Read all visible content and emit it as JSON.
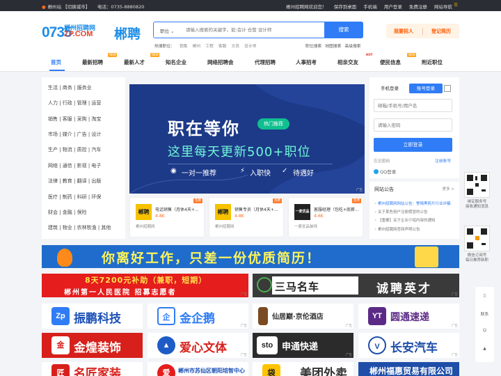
{
  "topbar": {
    "site": "郴州站",
    "switch_city": "【切换城市】",
    "phone": "电话：0735-8880820",
    "welcome": "郴州招聘网欢迎您！",
    "links": [
      "保存到桌面",
      "手机端",
      "用户登录",
      "免费注册",
      "网站导航"
    ]
  },
  "header": {
    "logo_num": "0735",
    "logo_cn": "郴州招聘网",
    "logo_domain": "ZP.COM",
    "logo_brand": "郴聘",
    "search_category": "职位",
    "search_placeholder": "请输入搜索的关键字，如:会计 仓管 设计师",
    "search_button": "搜索",
    "hot_label": "热搜职位：",
    "hot_keywords": [
      "销售",
      "郴州",
      "工程",
      "客服",
      "文员",
      "设计师"
    ],
    "right_links": [
      "职位搜索",
      "地图搜索",
      "高级搜索"
    ],
    "btn_recruit": "我要招人",
    "btn_resume": "登记简历"
  },
  "nav": {
    "items": [
      "首页",
      "最新招聘",
      "最新人才",
      "知名企业",
      "网络招聘会",
      "代理招聘",
      "人事招考",
      "相亲交友",
      "便民信息",
      "附近职位"
    ],
    "new_tag": "NEW",
    "hot_tag": "HOT"
  },
  "categories": [
    "生活 | 商务 | 服务业",
    "人力 | 行政 | 管理 | 运营",
    "销售 | 客服 | 采购 | 淘宝",
    "市场 | 媒介 | 广告 | 设计",
    "生产 | 物流 | 质控 | 汽车",
    "网络 | 通信 | 影视 | 电子",
    "法律 | 教育 | 翻译 | 出版",
    "医疗 | 制药 | 科研 | 环保",
    "财会 | 金融 | 保险",
    "建筑 | 物业 | 农林牧渔 | 其他"
  ],
  "banner": {
    "title": "职在等你",
    "pill": "热门推荐",
    "subtitle": "这里每天更新500+职位",
    "features": [
      "一对一推荐",
      "入职快",
      "待遇好"
    ],
    "ad_label": "广告"
  },
  "jobs": [
    {
      "logo": "郴聘",
      "title": "电话销售（月休4天+...",
      "salary": "4-8K",
      "company": "郴州招聘网",
      "tag": "急聘"
    },
    {
      "logo": "郴聘",
      "title": "销售专员（月休4天+...",
      "salary": "4-8K",
      "company": "郴州招聘网",
      "tag": "急聘"
    },
    {
      "logo": "一麦优品",
      "title": "客服经理（包吃+底薪...",
      "salary": "4-6K",
      "company": "一麦优品装饰",
      "tag": "急聘"
    }
  ],
  "login": {
    "tab_phone": "手机登录",
    "tab_account": "账号登录",
    "username_placeholder": "邮箱/手机号/用户名",
    "password_placeholder": "请输入密码",
    "submit": "立即登录",
    "forgot": "忘记密码",
    "register": "注册账号",
    "qq": "QQ登录"
  },
  "notice": {
    "title": "网站公告",
    "more": "更多 >",
    "items": [
      "郴州招聘网网站公告：警惕黑剪片行业诈骗",
      "关于某些用户注册假冒的公告",
      "【重要】关于企业介绍内审的通知",
      "郴州招聘网官网声明公告"
    ]
  },
  "side": {
    "qr1_caption": [
      "微信",
      "绑定服务号",
      "接收通知消息"
    ],
    "qr2_caption": [
      "微信订阅号",
      "每日推荐新职"
    ],
    "tools": [
      "反馈",
      "联系",
      "客服",
      "顶部"
    ]
  },
  "ads": {
    "big": "你离好工作，只差一份优质简历！",
    "ad_label": "广告",
    "hospital_line1": "8天7200元补助（兼职，短期）",
    "hospital_line2": "郴州第一人民医院  招募志愿者",
    "car_left": "三马名车",
    "car_right": "诚聘英才",
    "tiles": [
      "振鹏科技",
      "金企鹅",
      "仙居巅·京伦酒店",
      "圆通速递",
      "金煌装饰",
      "爱心文体",
      "申通快递",
      "长安汽车",
      "名匠家装",
      "郴州市苏仙区朝阳培智中心",
      "美团外卖",
      "郴州福惠贸易有限公司"
    ]
  },
  "colors": {
    "primary": "#2f7cf6",
    "accent": "#ff5a00",
    "topbar": "#2a2d33"
  }
}
